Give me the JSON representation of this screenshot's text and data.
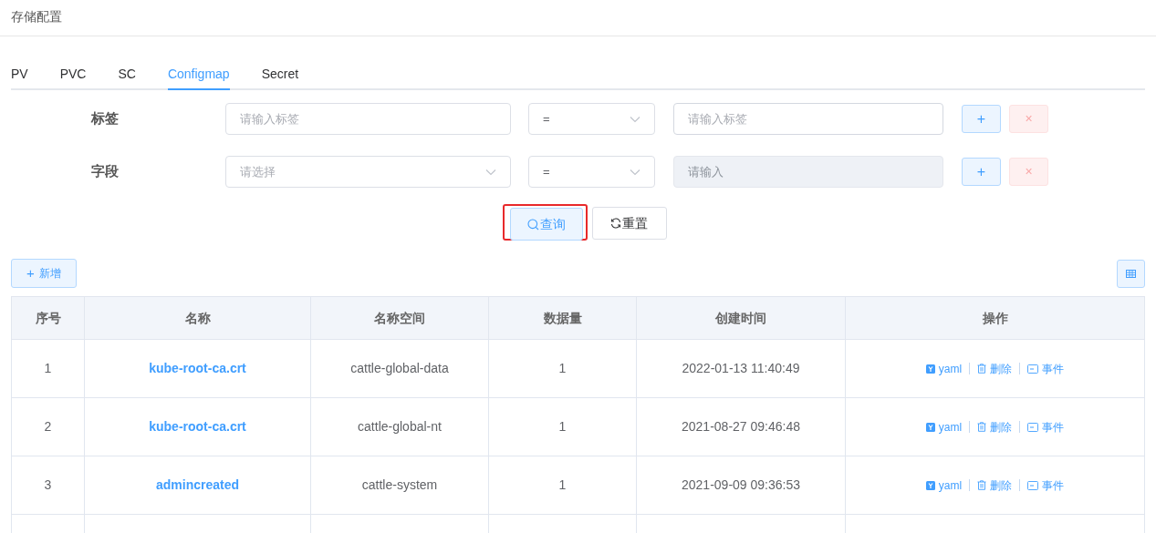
{
  "page_title": "存储配置",
  "tabs": [
    {
      "label": "PV",
      "selected": false
    },
    {
      "label": "PVC",
      "selected": false
    },
    {
      "label": "SC",
      "selected": false
    },
    {
      "label": "Configmap",
      "selected": true
    },
    {
      "label": "Secret",
      "selected": false
    }
  ],
  "filters": [
    {
      "label": "标签",
      "key_field": {
        "kind": "input",
        "placeholder": "请输入标签"
      },
      "operator": "=",
      "value_field": {
        "placeholder": "请输入标签",
        "disabled": false
      },
      "add": "+",
      "remove": "×"
    },
    {
      "label": "字段",
      "key_field": {
        "kind": "select",
        "placeholder": "请选择"
      },
      "operator": "=",
      "value_field": {
        "placeholder": "请输入",
        "disabled": true
      },
      "add": "+",
      "remove": "×"
    }
  ],
  "actions": [
    {
      "kind": "search",
      "label": "查询",
      "highlighted": true
    },
    {
      "kind": "reset",
      "label": "重置",
      "highlighted": false
    }
  ],
  "add_button": {
    "icon": "+",
    "label": "新增"
  },
  "table": {
    "columns": [
      "序号",
      "名称",
      "名称空间",
      "数据量",
      "创建时间",
      "操作"
    ],
    "rows": [
      {
        "index": "1",
        "name": "kube-root-ca.crt",
        "namespace": "cattle-global-data",
        "data_count": "1",
        "created": "2022-01-13 11:40:49",
        "ops": [
          "yaml",
          "删除",
          "事件"
        ]
      },
      {
        "index": "2",
        "name": "kube-root-ca.crt",
        "namespace": "cattle-global-nt",
        "data_count": "1",
        "created": "2021-08-27 09:46:48",
        "ops": [
          "yaml",
          "删除",
          "事件"
        ]
      },
      {
        "index": "3",
        "name": "admincreated",
        "namespace": "cattle-system",
        "data_count": "1",
        "created": "2021-09-09 09:36:53",
        "ops": [
          "yaml",
          "删除",
          "事件"
        ]
      }
    ]
  }
}
